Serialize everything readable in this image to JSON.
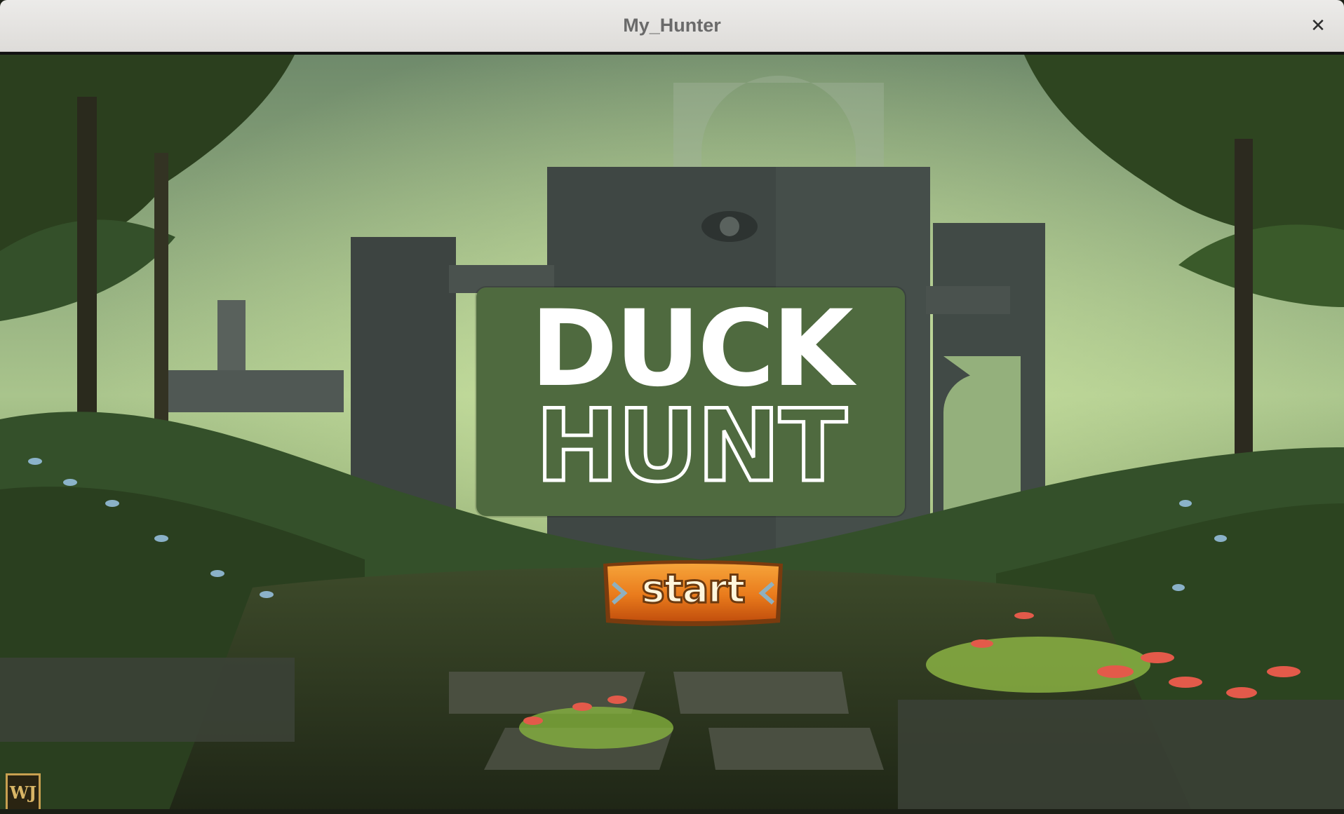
{
  "window": {
    "title": "My_Hunter",
    "close_glyph": "✕"
  },
  "game": {
    "logo": {
      "line1": "DUCK",
      "line2": "HUNT",
      "panel_color": "#4f6a3f"
    },
    "start_button": {
      "label": "start",
      "color": "#e97b1c"
    },
    "watermark": "WJ",
    "scene": "forest ruins background",
    "icons": [
      "close-icon",
      "arrow-chevron-icon"
    ]
  }
}
